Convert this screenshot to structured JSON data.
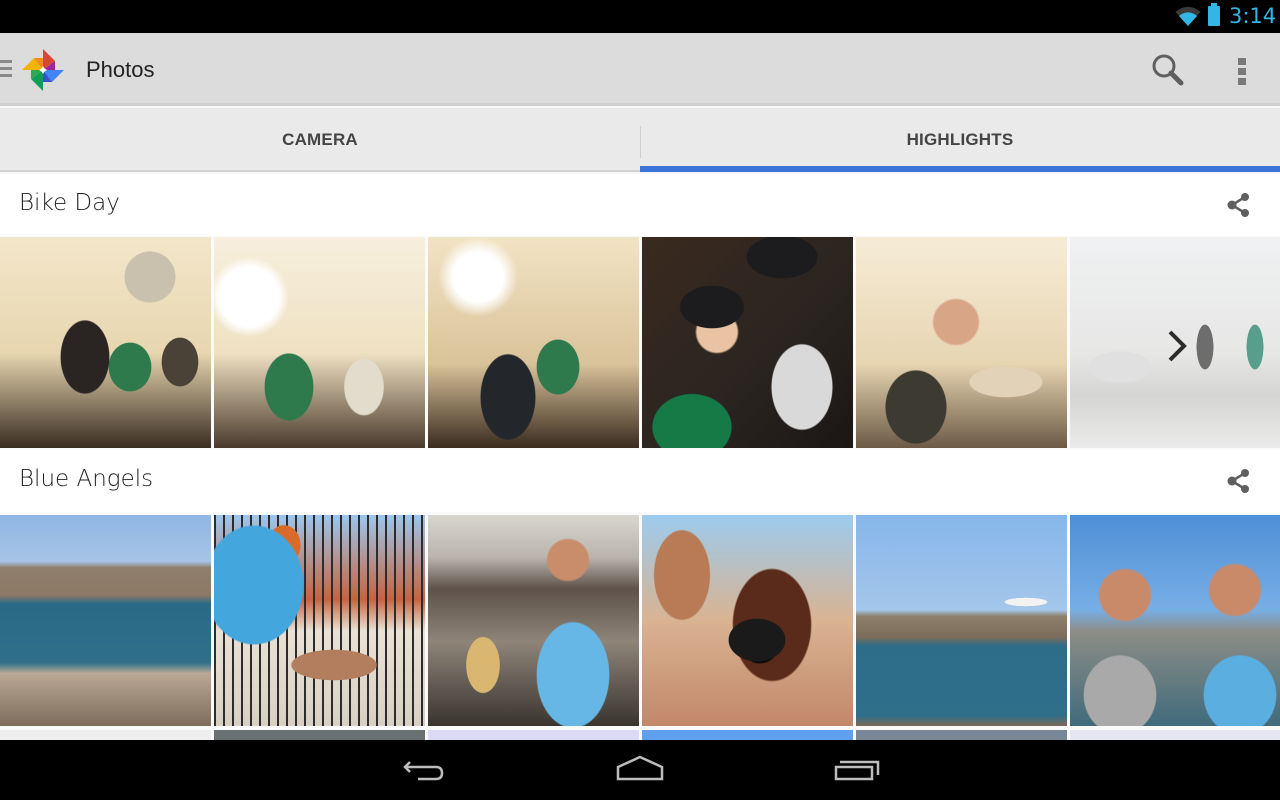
{
  "status_bar": {
    "time": "3:14",
    "wifi_icon": "wifi-icon",
    "battery_icon": "battery-icon",
    "accent_color": "#33b5e5"
  },
  "action_bar": {
    "title": "Photos",
    "menu_icon": "hamburger-icon",
    "logo_icon": "photos-pinwheel-icon",
    "search_icon": "search-icon",
    "overflow_icon": "more-vert-icon"
  },
  "tabs": [
    {
      "label": "CAMERA",
      "selected": false
    },
    {
      "label": "HIGHLIGHTS",
      "selected": true
    }
  ],
  "tab_indicator_color": "#3b73d9",
  "sections": [
    {
      "title": "Bike Day",
      "share_icon": "share-icon",
      "photos": [
        {
          "description": "Three friends in bike shop looking up"
        },
        {
          "description": "Woman and man smiling in bike shop"
        },
        {
          "description": "Friends looking at phone in bike shop"
        },
        {
          "description": "Man fastening woman's helmet"
        },
        {
          "description": "Man reaching for bike on wall"
        },
        {
          "description": "Two cyclists riding on city street",
          "has_more_chevron": true
        }
      ]
    },
    {
      "title": "Blue Angels",
      "share_icon": "share-icon",
      "photos": [
        {
          "description": "Alcatraz island and bay with sailboats"
        },
        {
          "description": "Men opening champagne on balcony"
        },
        {
          "description": "Man with camera and woman in sunglasses"
        },
        {
          "description": "Woman taking photo with Canon camera"
        },
        {
          "description": "Airplane flying over Alcatraz"
        },
        {
          "description": "Two men smiling by the bay"
        }
      ]
    }
  ],
  "nav_bar": {
    "back_icon": "back-icon",
    "home_icon": "home-icon",
    "recents_icon": "recents-icon"
  }
}
